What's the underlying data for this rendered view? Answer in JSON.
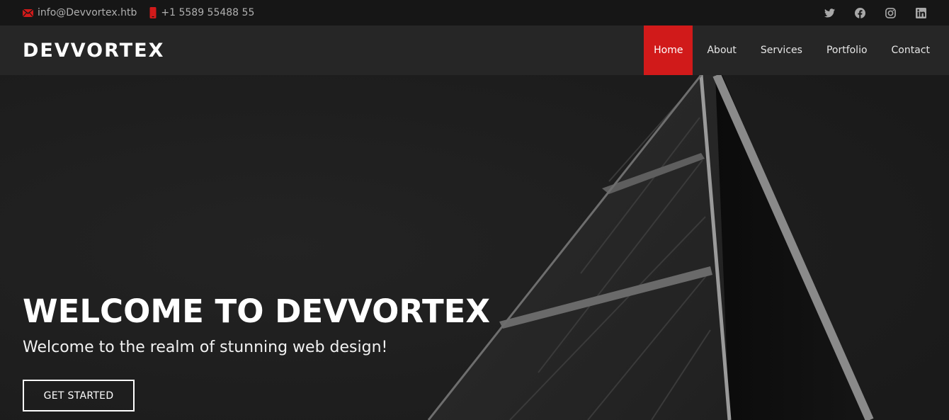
{
  "topbar": {
    "email": "info@Devvortex.htb",
    "phone": "+1 5589 55488 55",
    "socials": [
      "twitter-icon",
      "facebook-icon",
      "instagram-icon",
      "linkedin-icon"
    ]
  },
  "header": {
    "logo": "DEVVORTEX",
    "nav": [
      {
        "label": "Home",
        "active": true
      },
      {
        "label": "About",
        "active": false
      },
      {
        "label": "Services",
        "active": false
      },
      {
        "label": "Portfolio",
        "active": false
      },
      {
        "label": "Contact",
        "active": false
      }
    ]
  },
  "hero": {
    "title": "WELCOME TO DEVVORTEX",
    "subtitle": "Welcome to the realm of stunning web design!",
    "cta_label": "GET STARTED"
  },
  "colors": {
    "accent": "#d11a1a",
    "topbar_bg": "#161616",
    "header_bg": "#262626",
    "hero_bg": "#1c1c1c"
  }
}
